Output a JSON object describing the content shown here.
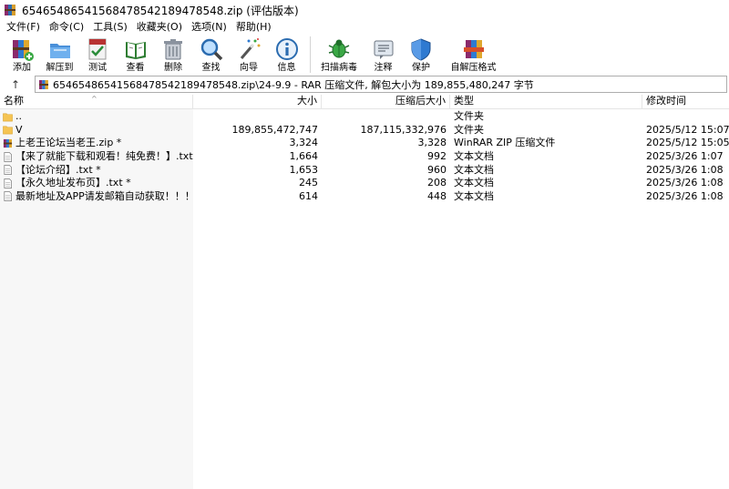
{
  "window": {
    "title": "65465486541568478542189478548.zip (评估版本)"
  },
  "menu": [
    {
      "label": "文件(F)"
    },
    {
      "label": "命令(C)"
    },
    {
      "label": "工具(S)"
    },
    {
      "label": "收藏夹(O)"
    },
    {
      "label": "选项(N)"
    },
    {
      "label": "帮助(H)"
    }
  ],
  "toolbar": {
    "add": "添加",
    "extract_to": "解压到",
    "test": "测试",
    "view": "查看",
    "delete": "删除",
    "find": "查找",
    "wizard": "向导",
    "info": "信息",
    "scan": "扫描病毒",
    "comment": "注释",
    "protect": "保护",
    "sfx": "自解压格式"
  },
  "address": {
    "path": "65465486541568478542189478548.zip\\24-9.9 - RAR 压缩文件, 解包大小为 189,855,480,247 字节",
    "up_symbol": "↑"
  },
  "columns": {
    "name": "名称",
    "size": "大小",
    "packed": "压缩后大小",
    "type": "类型",
    "modified": "修改时间"
  },
  "files": [
    {
      "icon": "folder-up-icon",
      "name": "..",
      "size": "",
      "packed": "",
      "type": "文件夹",
      "modified": ""
    },
    {
      "icon": "folder-icon",
      "name": "V",
      "size": "189,855,472,747",
      "packed": "187,115,332,976",
      "type": "文件夹",
      "modified": "2025/5/12 15:07"
    },
    {
      "icon": "zip-archive-icon",
      "name": "上老王论坛当老王.zip *",
      "size": "3,324",
      "packed": "3,328",
      "type": "WinRAR ZIP 压缩文件",
      "modified": "2025/5/12 15:05"
    },
    {
      "icon": "text-file-icon",
      "name": "【来了就能下载和观看！纯免费！】.txt *",
      "size": "1,664",
      "packed": "992",
      "type": "文本文档",
      "modified": "2025/3/26 1:07"
    },
    {
      "icon": "text-file-icon",
      "name": "【论坛介绍】.txt *",
      "size": "1,653",
      "packed": "960",
      "type": "文本文档",
      "modified": "2025/3/26 1:08"
    },
    {
      "icon": "text-file-icon",
      "name": "【永久地址发布页】.txt *",
      "size": "245",
      "packed": "208",
      "type": "文本文档",
      "modified": "2025/3/26 1:08"
    },
    {
      "icon": "text-file-icon",
      "name": "最新地址及APP请发邮箱自动获取！！！.txt *",
      "size": "614",
      "packed": "448",
      "type": "文本文档",
      "modified": "2025/3/26 1:08"
    }
  ],
  "colors": {
    "folder": "#f5c453",
    "accent": "#1e5fb4",
    "header_border": "#e5e5e5"
  }
}
